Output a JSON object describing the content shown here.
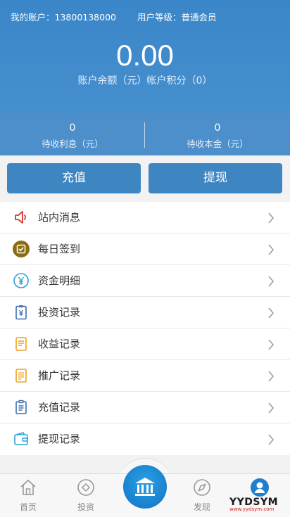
{
  "account": {
    "label_account": "我的账户：",
    "account_no": "13800138000",
    "label_level": "用户等级：",
    "level": "普通会员"
  },
  "balance": {
    "amount": "0.00",
    "subtitle": "账户余额（元）帐户积分（0）"
  },
  "stats": [
    {
      "value": "0",
      "label": "待收利息（元）"
    },
    {
      "value": "0",
      "label": "待收本金（元）"
    }
  ],
  "actions": {
    "recharge": "充值",
    "withdraw": "提现"
  },
  "menu": [
    {
      "label": "站内消息",
      "icon": "speaker-icon",
      "color": "#d9342b"
    },
    {
      "label": "每日签到",
      "icon": "checkin-icon",
      "color": "#8a6d12"
    },
    {
      "label": "资金明细",
      "icon": "yuan-circle-icon",
      "color": "#2aa0d8"
    },
    {
      "label": "投资记录",
      "icon": "invest-doc-icon",
      "color": "#3d6fb0"
    },
    {
      "label": "收益记录",
      "icon": "income-doc-icon",
      "color": "#f0a020"
    },
    {
      "label": "推广记录",
      "icon": "promo-doc-icon",
      "color": "#f0a020"
    },
    {
      "label": "充值记录",
      "icon": "clipboard-icon",
      "color": "#3d6fb0"
    },
    {
      "label": "提现记录",
      "icon": "wallet-icon",
      "color": "#2aa0d8"
    }
  ],
  "tabs": {
    "home": "首页",
    "invest": "投资",
    "discover": "发现"
  },
  "watermark": {
    "brand": "YYDSYM",
    "url": "www.yydsym.com"
  },
  "colors": {
    "header": "#3a86c8",
    "button": "#3e86c2",
    "tab_active": "#1273c2"
  }
}
